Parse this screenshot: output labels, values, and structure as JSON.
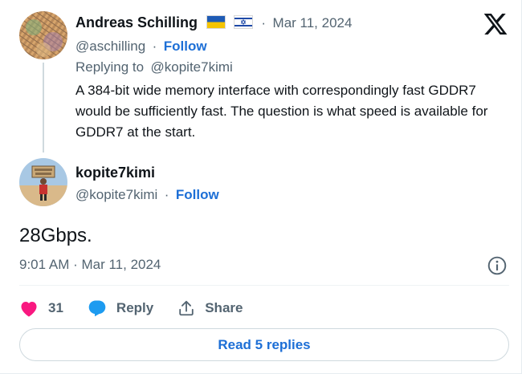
{
  "parent_tweet": {
    "author_name": "Andreas Schilling",
    "flags": [
      "ukraine-flag",
      "israel-flag"
    ],
    "separator": "·",
    "date": "Mar 11, 2024",
    "handle": "@aschilling",
    "follow_label": "Follow",
    "replying_to_prefix": "Replying to",
    "replying_to_handle": "@kopite7kimi",
    "text": "A 384-bit wide memory interface with correspondingly fast GDDR7 would be sufficiently fast. The question is what speed is available for GDDR7 at the start."
  },
  "main_tweet": {
    "author_name": "kopite7kimi",
    "handle": "@kopite7kimi",
    "separator": "·",
    "follow_label": "Follow",
    "text": "28Gbps.",
    "timestamp": "9:01 AM · Mar 11, 2024"
  },
  "actions": {
    "like_count": "31",
    "reply_label": "Reply",
    "share_label": "Share"
  },
  "read_replies_label": "Read 5 replies",
  "colors": {
    "accent": "#1d6fd6",
    "like": "#f91880",
    "muted": "#536471",
    "text": "#0f1419"
  },
  "icons": {
    "logo": "x-logo-icon",
    "info": "info-icon",
    "like": "heart-icon",
    "reply": "reply-bubble-icon",
    "share": "share-upload-icon"
  }
}
